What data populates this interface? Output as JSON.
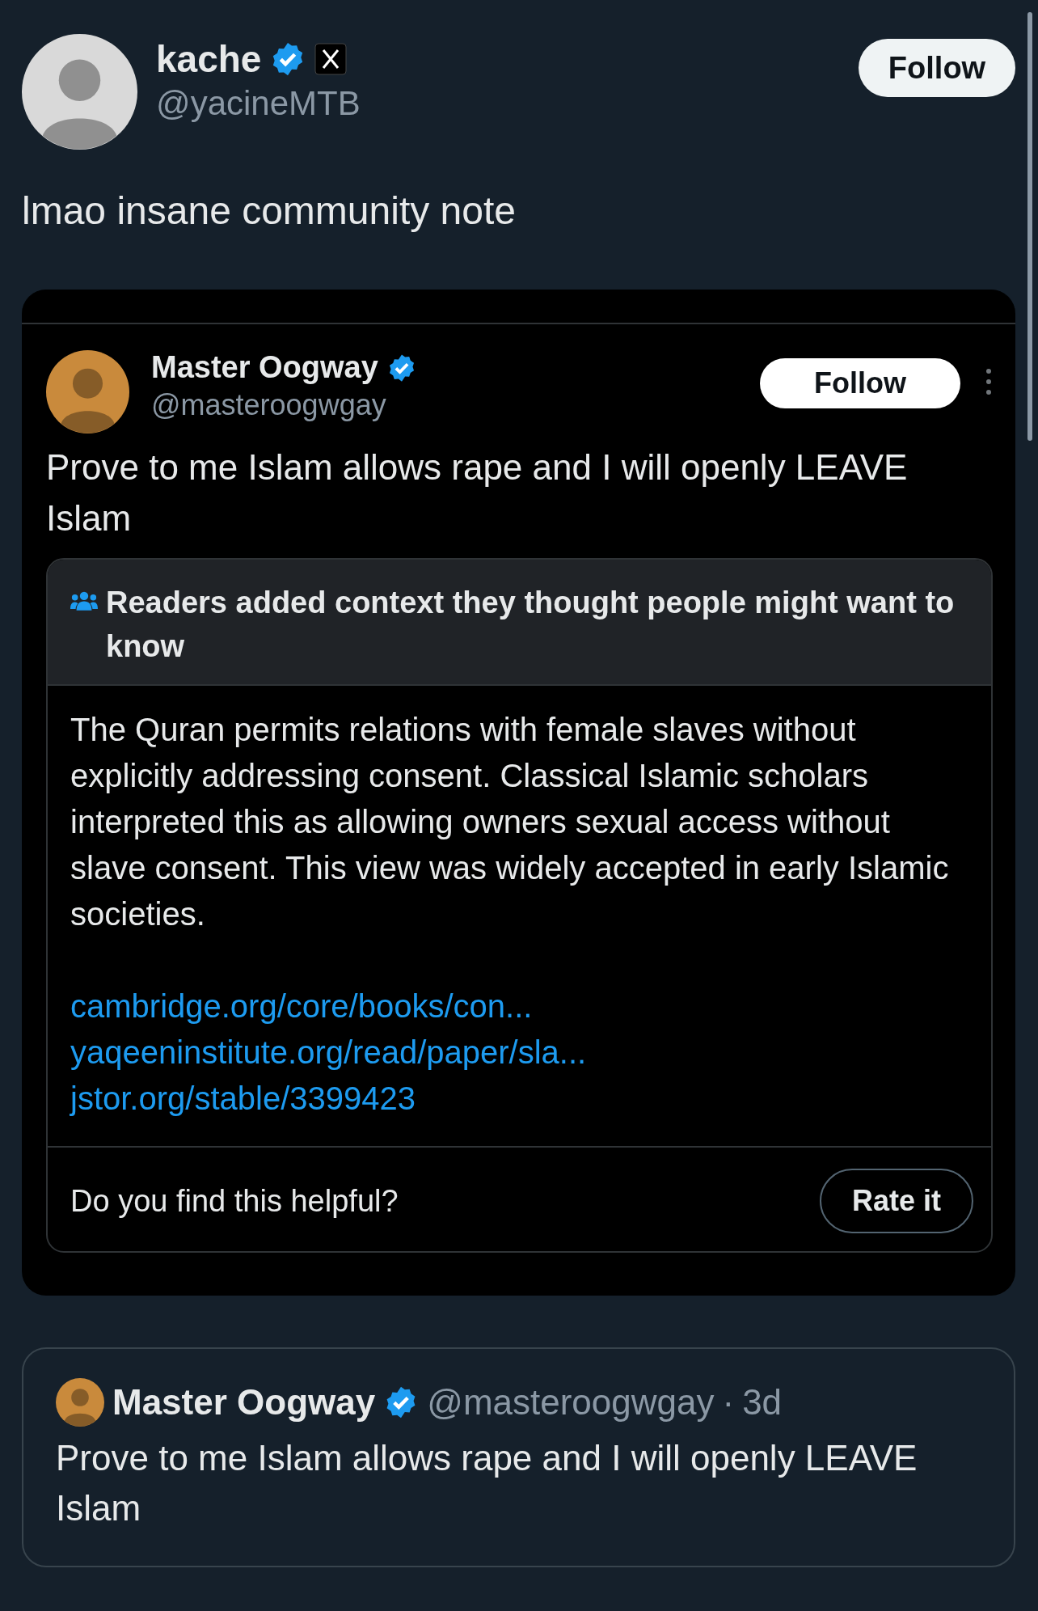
{
  "post": {
    "author": {
      "name": "kache",
      "handle": "@yacineMTB",
      "verified": true,
      "logo_badge": true
    },
    "follow_button": "Follow",
    "text": "lmao insane community note"
  },
  "screenshot": {
    "author": {
      "name": "Master Oogway",
      "handle": "@masteroogwgay",
      "verified": true
    },
    "follow_button": "Follow",
    "text": "Prove to me Islam allows rape and I will openly LEAVE Islam",
    "note": {
      "header": "Readers added context they thought people might want to know",
      "body": "The Quran permits relations with female slaves without explicitly addressing consent. Classical Islamic scholars interpreted this as allowing owners sexual access without slave consent. This view was widely accepted in early Islamic societies.",
      "links": [
        "cambridge.org/core/books/con...",
        "yaqeeninstitute.org/read/paper/sla...",
        "jstor.org/stable/3399423"
      ],
      "prompt": "Do you find this helpful?",
      "rate_button": "Rate it"
    }
  },
  "quoted_post": {
    "author": {
      "name": "Master Oogway",
      "handle": "@masteroogwgay",
      "verified": true
    },
    "separator": "·",
    "time": "3d",
    "text": "Prove to me Islam allows rape and I will openly LEAVE Islam"
  }
}
